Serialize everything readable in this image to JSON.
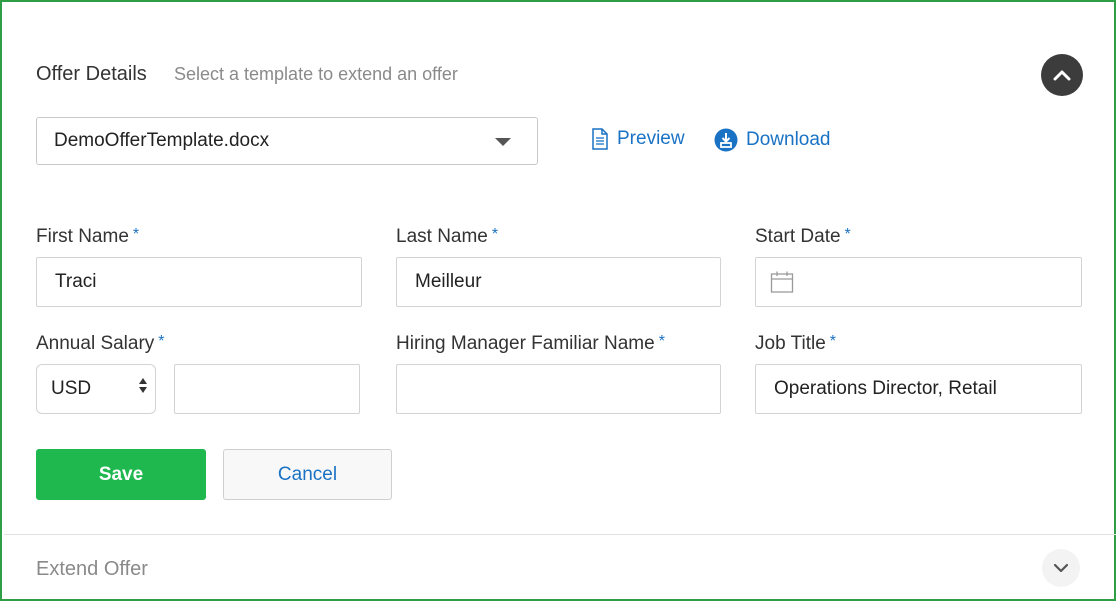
{
  "offer_details": {
    "title": "Offer Details",
    "subtitle": "Select a template to extend an offer",
    "template_value": "DemoOfferTemplate.docx",
    "preview_label": "Preview",
    "download_label": "Download"
  },
  "form": {
    "required_mark": "*",
    "first_name": {
      "label": "First Name",
      "value": "Traci"
    },
    "last_name": {
      "label": "Last Name",
      "value": "Meilleur"
    },
    "start_date": {
      "label": "Start Date",
      "value": ""
    },
    "annual_salary": {
      "label": "Annual Salary",
      "currency": "USD",
      "value": ""
    },
    "hiring_manager": {
      "label": "Hiring Manager Familiar Name",
      "value": ""
    },
    "job_title": {
      "label": "Job Title",
      "value": "Operations Director, Retail"
    }
  },
  "actions": {
    "save_label": "Save",
    "cancel_label": "Cancel"
  },
  "extend_offer": {
    "title": "Extend Offer"
  },
  "colors": {
    "accent_blue": "#1a72c4",
    "save_green": "#1fb84f",
    "frame_green": "#2f9e44"
  },
  "icons": {
    "collapse": "chevron-up-icon",
    "expand": "chevron-down-icon",
    "preview": "document-icon",
    "download": "download-icon",
    "calendar": "calendar-icon"
  }
}
